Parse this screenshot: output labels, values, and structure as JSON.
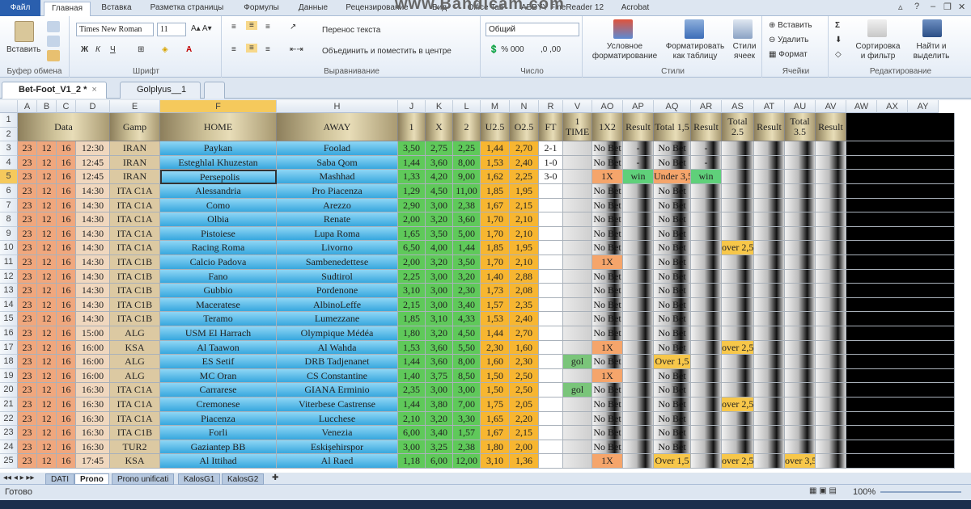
{
  "ribbon_tabs": [
    "Файл",
    "Главная",
    "Вставка",
    "Разметка страницы",
    "Формулы",
    "Данные",
    "Рецензирование",
    "Вид",
    "Office Tab",
    "ABBYY FineReader 12",
    "Acrobat"
  ],
  "watermark": "www.Bandicam.com",
  "clipboard": {
    "paste": "Вставить",
    "label": "Буфер обмена"
  },
  "font": {
    "name": "Times New Roman",
    "size": "11",
    "label": "Шрифт"
  },
  "alignment": {
    "wrap": "Перенос текста",
    "merge": "Объединить и поместить в центре",
    "label": "Выравнивание"
  },
  "number": {
    "format": "Общий",
    "label": "Число"
  },
  "styles": {
    "conditional": "Условное форматирование",
    "as_table": "Форматировать как таблицу",
    "cell_styles": "Стили ячеек",
    "label": "Стили"
  },
  "cells": {
    "insert": "Вставить",
    "delete": "Удалить",
    "format": "Формат",
    "label": "Ячейки"
  },
  "editing": {
    "sort": "Сортировка и фильтр",
    "find": "Найти и выделить",
    "label": "Редактирование"
  },
  "doc_tabs": [
    {
      "name": "Bet-Foot_V1_2 *"
    },
    {
      "name": "Golplyus__1"
    }
  ],
  "columns": [
    "A",
    "B",
    "C",
    "D",
    "E",
    "F",
    "H",
    "J",
    "K",
    "L",
    "M",
    "N",
    "R",
    "V",
    "AO",
    "AP",
    "AQ",
    "AR",
    "AS",
    "AT",
    "AU",
    "AV",
    "AW",
    "AX",
    "AY"
  ],
  "headers": {
    "data": "Data",
    "gamp": "Gamp",
    "home": "HOME",
    "away": "AWAY",
    "one": "1",
    "x": "X",
    "two": "2",
    "u25": "U2.5",
    "o25": "O2.5",
    "ft": "FT",
    "time1": "1 TIME",
    "x12": "1X2",
    "result1": "Result",
    "total15": "Total 1,5",
    "result2": "Result",
    "total25": "Total 2.5",
    "result3": "Result",
    "total35": "Total 3.5",
    "result4": "Result"
  },
  "rows": [
    {
      "r": "3",
      "d": "23",
      "m": "12",
      "y": "16",
      "t": "12:30",
      "g": "IRAN",
      "home": "Paykan",
      "away": "Foolad",
      "o1": "3,50",
      "ox": "2,75",
      "o2": "2,25",
      "u": "1,44",
      "o": "2,70",
      "ft": "2-1",
      "t1": "",
      "x12": "No Bet",
      "res1": "-",
      "t15": "No Bet",
      "res2": "-",
      "t25": "",
      "t35": ""
    },
    {
      "r": "4",
      "d": "23",
      "m": "12",
      "y": "16",
      "t": "12:45",
      "g": "IRAN",
      "home": "Esteghlal Khuzestan",
      "away": "Saba Qom",
      "o1": "1,44",
      "ox": "3,60",
      "o2": "8,00",
      "u": "1,53",
      "o": "2,40",
      "ft": "1-0",
      "t1": "",
      "x12": "No Bet",
      "res1": "-",
      "t15": "No Bet",
      "res2": "-",
      "t25": "",
      "t35": ""
    },
    {
      "r": "5",
      "d": "23",
      "m": "12",
      "y": "16",
      "t": "12:45",
      "g": "IRAN",
      "home": "Persepolis",
      "away": "Mashhad",
      "o1": "1,33",
      "ox": "4,20",
      "o2": "9,00",
      "u": "1,62",
      "o": "2,25",
      "ft": "3-0",
      "t1": "",
      "x12": "1X",
      "res1": "win",
      "t15": "Under 3,5",
      "res2": "win",
      "t25": "",
      "t35": ""
    },
    {
      "r": "6",
      "d": "23",
      "m": "12",
      "y": "16",
      "t": "14:30",
      "g": "ITA C1A",
      "home": "Alessandria",
      "away": "Pro Piacenza",
      "o1": "1,29",
      "ox": "4,50",
      "o2": "11,00",
      "u": "1,85",
      "o": "1,95",
      "ft": "",
      "t1": "",
      "x12": "No Bet",
      "res1": "",
      "t15": "No Bet",
      "res2": "",
      "t25": "",
      "t35": ""
    },
    {
      "r": "7",
      "d": "23",
      "m": "12",
      "y": "16",
      "t": "14:30",
      "g": "ITA C1A",
      "home": "Como",
      "away": "Arezzo",
      "o1": "2,90",
      "ox": "3,00",
      "o2": "2,38",
      "u": "1,67",
      "o": "2,15",
      "ft": "",
      "t1": "",
      "x12": "No Bet",
      "res1": "",
      "t15": "No Bet",
      "res2": "",
      "t25": "",
      "t35": ""
    },
    {
      "r": "8",
      "d": "23",
      "m": "12",
      "y": "16",
      "t": "14:30",
      "g": "ITA C1A",
      "home": "Olbia",
      "away": "Renate",
      "o1": "2,00",
      "ox": "3,20",
      "o2": "3,60",
      "u": "1,70",
      "o": "2,10",
      "ft": "",
      "t1": "",
      "x12": "No Bet",
      "res1": "",
      "t15": "No Bet",
      "res2": "",
      "t25": "",
      "t35": ""
    },
    {
      "r": "9",
      "d": "23",
      "m": "12",
      "y": "16",
      "t": "14:30",
      "g": "ITA C1A",
      "home": "Pistoiese",
      "away": "Lupa Roma",
      "o1": "1,65",
      "ox": "3,50",
      "o2": "5,00",
      "u": "1,70",
      "o": "2,10",
      "ft": "",
      "t1": "",
      "x12": "No Bet",
      "res1": "",
      "t15": "No Bet",
      "res2": "",
      "t25": "",
      "t35": ""
    },
    {
      "r": "10",
      "d": "23",
      "m": "12",
      "y": "16",
      "t": "14:30",
      "g": "ITA C1A",
      "home": "Racing Roma",
      "away": "Livorno",
      "o1": "6,50",
      "ox": "4,00",
      "o2": "1,44",
      "u": "1,85",
      "o": "1,95",
      "ft": "",
      "t1": "",
      "x12": "No Bet",
      "res1": "",
      "t15": "No Bet",
      "res2": "",
      "t25": "over 2,5",
      "t35": ""
    },
    {
      "r": "11",
      "d": "23",
      "m": "12",
      "y": "16",
      "t": "14:30",
      "g": "ITA C1B",
      "home": "Calcio Padova",
      "away": "Sambenedettese",
      "o1": "2,00",
      "ox": "3,20",
      "o2": "3,50",
      "u": "1,70",
      "o": "2,10",
      "ft": "",
      "t1": "",
      "x12": "1X",
      "res1": "",
      "t15": "No Bet",
      "res2": "",
      "t25": "",
      "t35": ""
    },
    {
      "r": "12",
      "d": "23",
      "m": "12",
      "y": "16",
      "t": "14:30",
      "g": "ITA C1B",
      "home": "Fano",
      "away": "Sudtirol",
      "o1": "2,25",
      "ox": "3,00",
      "o2": "3,20",
      "u": "1,40",
      "o": "2,88",
      "ft": "",
      "t1": "",
      "x12": "No Bet",
      "res1": "",
      "t15": "No Bet",
      "res2": "",
      "t25": "",
      "t35": ""
    },
    {
      "r": "13",
      "d": "23",
      "m": "12",
      "y": "16",
      "t": "14:30",
      "g": "ITA C1B",
      "home": "Gubbio",
      "away": "Pordenone",
      "o1": "3,10",
      "ox": "3,00",
      "o2": "2,30",
      "u": "1,73",
      "o": "2,08",
      "ft": "",
      "t1": "",
      "x12": "No Bet",
      "res1": "",
      "t15": "No Bet",
      "res2": "",
      "t25": "",
      "t35": ""
    },
    {
      "r": "14",
      "d": "23",
      "m": "12",
      "y": "16",
      "t": "14:30",
      "g": "ITA C1B",
      "home": "Maceratese",
      "away": "AlbinoLeffe",
      "o1": "2,15",
      "ox": "3,00",
      "o2": "3,40",
      "u": "1,57",
      "o": "2,35",
      "ft": "",
      "t1": "",
      "x12": "No Bet",
      "res1": "",
      "t15": "No Bet",
      "res2": "",
      "t25": "",
      "t35": ""
    },
    {
      "r": "15",
      "d": "23",
      "m": "12",
      "y": "16",
      "t": "14:30",
      "g": "ITA C1B",
      "home": "Teramo",
      "away": "Lumezzane",
      "o1": "1,85",
      "ox": "3,10",
      "o2": "4,33",
      "u": "1,53",
      "o": "2,40",
      "ft": "",
      "t1": "",
      "x12": "No Bet",
      "res1": "",
      "t15": "No Bet",
      "res2": "",
      "t25": "",
      "t35": ""
    },
    {
      "r": "16",
      "d": "23",
      "m": "12",
      "y": "16",
      "t": "15:00",
      "g": "ALG",
      "home": "USM El Harrach",
      "away": "Olympique Médéa",
      "o1": "1,80",
      "ox": "3,20",
      "o2": "4,50",
      "u": "1,44",
      "o": "2,70",
      "ft": "",
      "t1": "",
      "x12": "No Bet",
      "res1": "",
      "t15": "No Bet",
      "res2": "",
      "t25": "",
      "t35": ""
    },
    {
      "r": "17",
      "d": "23",
      "m": "12",
      "y": "16",
      "t": "16:00",
      "g": "KSA",
      "home": "Al Taawon",
      "away": "Al Wahda",
      "o1": "1,53",
      "ox": "3,60",
      "o2": "5,50",
      "u": "2,30",
      "o": "1,60",
      "ft": "",
      "t1": "",
      "x12": "1X",
      "res1": "",
      "t15": "No Bet",
      "res2": "",
      "t25": "over 2,5",
      "t35": ""
    },
    {
      "r": "18",
      "d": "23",
      "m": "12",
      "y": "16",
      "t": "16:00",
      "g": "ALG",
      "home": "ES Setif",
      "away": "DRB Tadjenanet",
      "o1": "1,44",
      "ox": "3,60",
      "o2": "8,00",
      "u": "1,60",
      "o": "2,30",
      "ft": "",
      "t1": "gol",
      "x12": "No Bet",
      "res1": "",
      "t15": "Over 1,5",
      "res2": "",
      "t25": "",
      "t35": ""
    },
    {
      "r": "19",
      "d": "23",
      "m": "12",
      "y": "16",
      "t": "16:00",
      "g": "ALG",
      "home": "MC Oran",
      "away": "CS Constantine",
      "o1": "1,40",
      "ox": "3,75",
      "o2": "8,50",
      "u": "1,50",
      "o": "2,50",
      "ft": "",
      "t1": "",
      "x12": "1X",
      "res1": "",
      "t15": "No Bet",
      "res2": "",
      "t25": "",
      "t35": ""
    },
    {
      "r": "20",
      "d": "23",
      "m": "12",
      "y": "16",
      "t": "16:30",
      "g": "ITA C1A",
      "home": "Carrarese",
      "away": "GIANA Erminio",
      "o1": "2,35",
      "ox": "3,00",
      "o2": "3,00",
      "u": "1,50",
      "o": "2,50",
      "ft": "",
      "t1": "gol",
      "x12": "No Bet",
      "res1": "",
      "t15": "No Bet",
      "res2": "",
      "t25": "",
      "t35": ""
    },
    {
      "r": "21",
      "d": "23",
      "m": "12",
      "y": "16",
      "t": "16:30",
      "g": "ITA C1A",
      "home": "Cremonese",
      "away": "Viterbese Castrense",
      "o1": "1,44",
      "ox": "3,80",
      "o2": "7,00",
      "u": "1,75",
      "o": "2,05",
      "ft": "",
      "t1": "",
      "x12": "No Bet",
      "res1": "",
      "t15": "No Bet",
      "res2": "",
      "t25": "over 2,5",
      "t35": ""
    },
    {
      "r": "22",
      "d": "23",
      "m": "12",
      "y": "16",
      "t": "16:30",
      "g": "ITA C1A",
      "home": "Piacenza",
      "away": "Lucchese",
      "o1": "2,10",
      "ox": "3,20",
      "o2": "3,30",
      "u": "1,65",
      "o": "2,20",
      "ft": "",
      "t1": "",
      "x12": "No Bet",
      "res1": "",
      "t15": "No Bet",
      "res2": "",
      "t25": "",
      "t35": ""
    },
    {
      "r": "23",
      "d": "23",
      "m": "12",
      "y": "16",
      "t": "16:30",
      "g": "ITA C1B",
      "home": "Forli",
      "away": "Venezia",
      "o1": "6,00",
      "ox": "3,40",
      "o2": "1,57",
      "u": "1,67",
      "o": "2,15",
      "ft": "",
      "t1": "",
      "x12": "No Bet",
      "res1": "",
      "t15": "No Bet",
      "res2": "",
      "t25": "",
      "t35": ""
    },
    {
      "r": "24",
      "d": "23",
      "m": "12",
      "y": "16",
      "t": "16:30",
      "g": "TUR2",
      "home": "Gaziantep BB",
      "away": "Eskişehirspor",
      "o1": "3,00",
      "ox": "3,25",
      "o2": "2,38",
      "u": "1,80",
      "o": "2,00",
      "ft": "",
      "t1": "",
      "x12": "No Bet",
      "res1": "",
      "t15": "No Bet",
      "res2": "",
      "t25": "",
      "t35": ""
    },
    {
      "r": "25",
      "d": "23",
      "m": "12",
      "y": "16",
      "t": "17:45",
      "g": "KSA",
      "home": "Al Ittihad",
      "away": "Al Raed",
      "o1": "1,18",
      "ox": "6,00",
      "o2": "12,00",
      "u": "3,10",
      "o": "1,36",
      "ft": "",
      "t1": "",
      "x12": "1X",
      "res1": "",
      "t15": "Over 1,5",
      "res2": "",
      "t25": "over 2,5",
      "t35": "over 3,5"
    }
  ],
  "sheet_tabs": [
    "DATI",
    "Prono",
    "Prono unificati",
    "KalosG1",
    "KalosG2"
  ],
  "status": "Готово",
  "zoom": "100%",
  "colors": {
    "date": "#f0a77d",
    "home": "#37a7de",
    "odds": "#5fc95a",
    "ou": "#f7b631"
  }
}
